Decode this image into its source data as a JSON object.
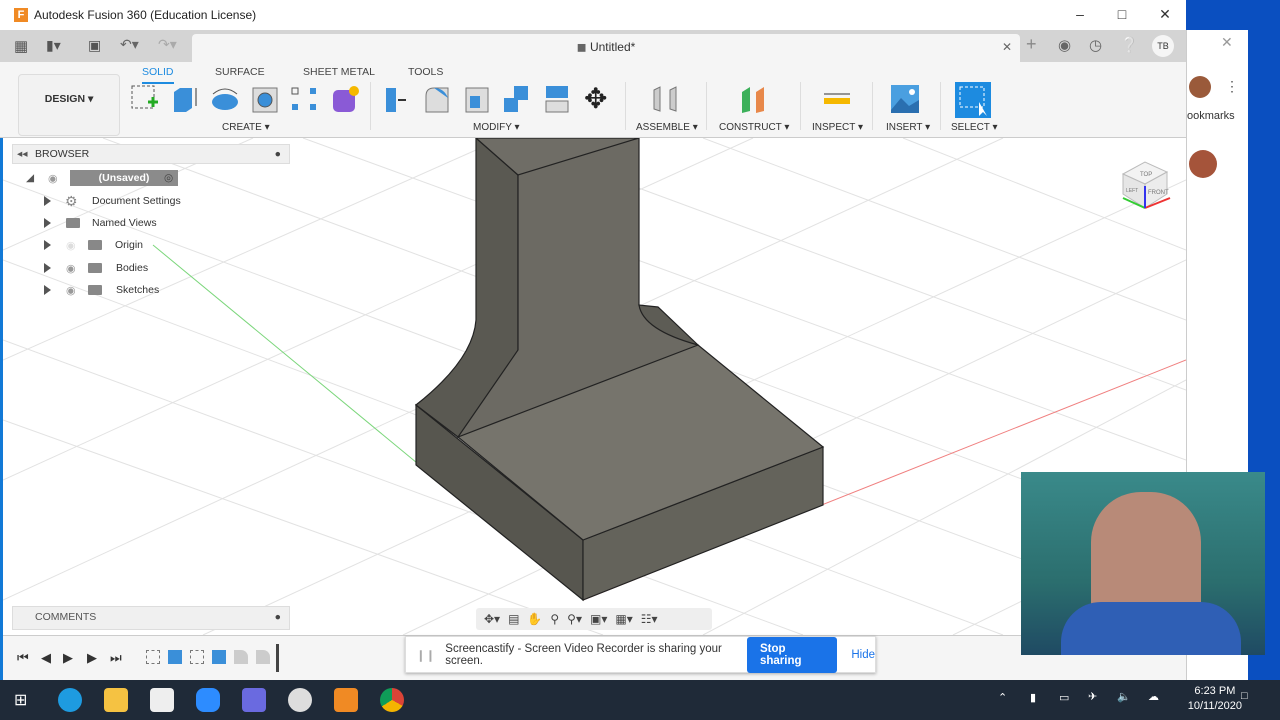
{
  "window": {
    "title": "Autodesk Fusion 360 (Education License)",
    "doc_title": "Untitled*",
    "user_initials": "TB"
  },
  "ribbon": {
    "workspace": "DESIGN",
    "tabs": [
      "SOLID",
      "SURFACE",
      "SHEET METAL",
      "TOOLS"
    ],
    "groups": [
      "CREATE",
      "MODIFY",
      "ASSEMBLE",
      "CONSTRUCT",
      "INSPECT",
      "INSERT",
      "SELECT"
    ]
  },
  "browser": {
    "header": "BROWSER",
    "root": "(Unsaved)",
    "items": [
      "Document Settings",
      "Named Views",
      "Origin",
      "Bodies",
      "Sketches"
    ]
  },
  "comments": "COMMENTS",
  "viewcube": {
    "faces": [
      "TOP",
      "FRONT",
      "LEFT"
    ]
  },
  "share_bar": {
    "message": "Screencastify - Screen Video Recorder is sharing your screen.",
    "stop": "Stop sharing",
    "hide": "Hide"
  },
  "chrome": {
    "bookmarks": "ookmarks"
  },
  "taskbar": {
    "time": "6:23 PM",
    "date": "10/11/2020"
  },
  "colors": {
    "accent": "#1d8be0",
    "share_button": "#1a73e8",
    "taskbar": "#1f2a38",
    "model": "#6b6a62"
  }
}
